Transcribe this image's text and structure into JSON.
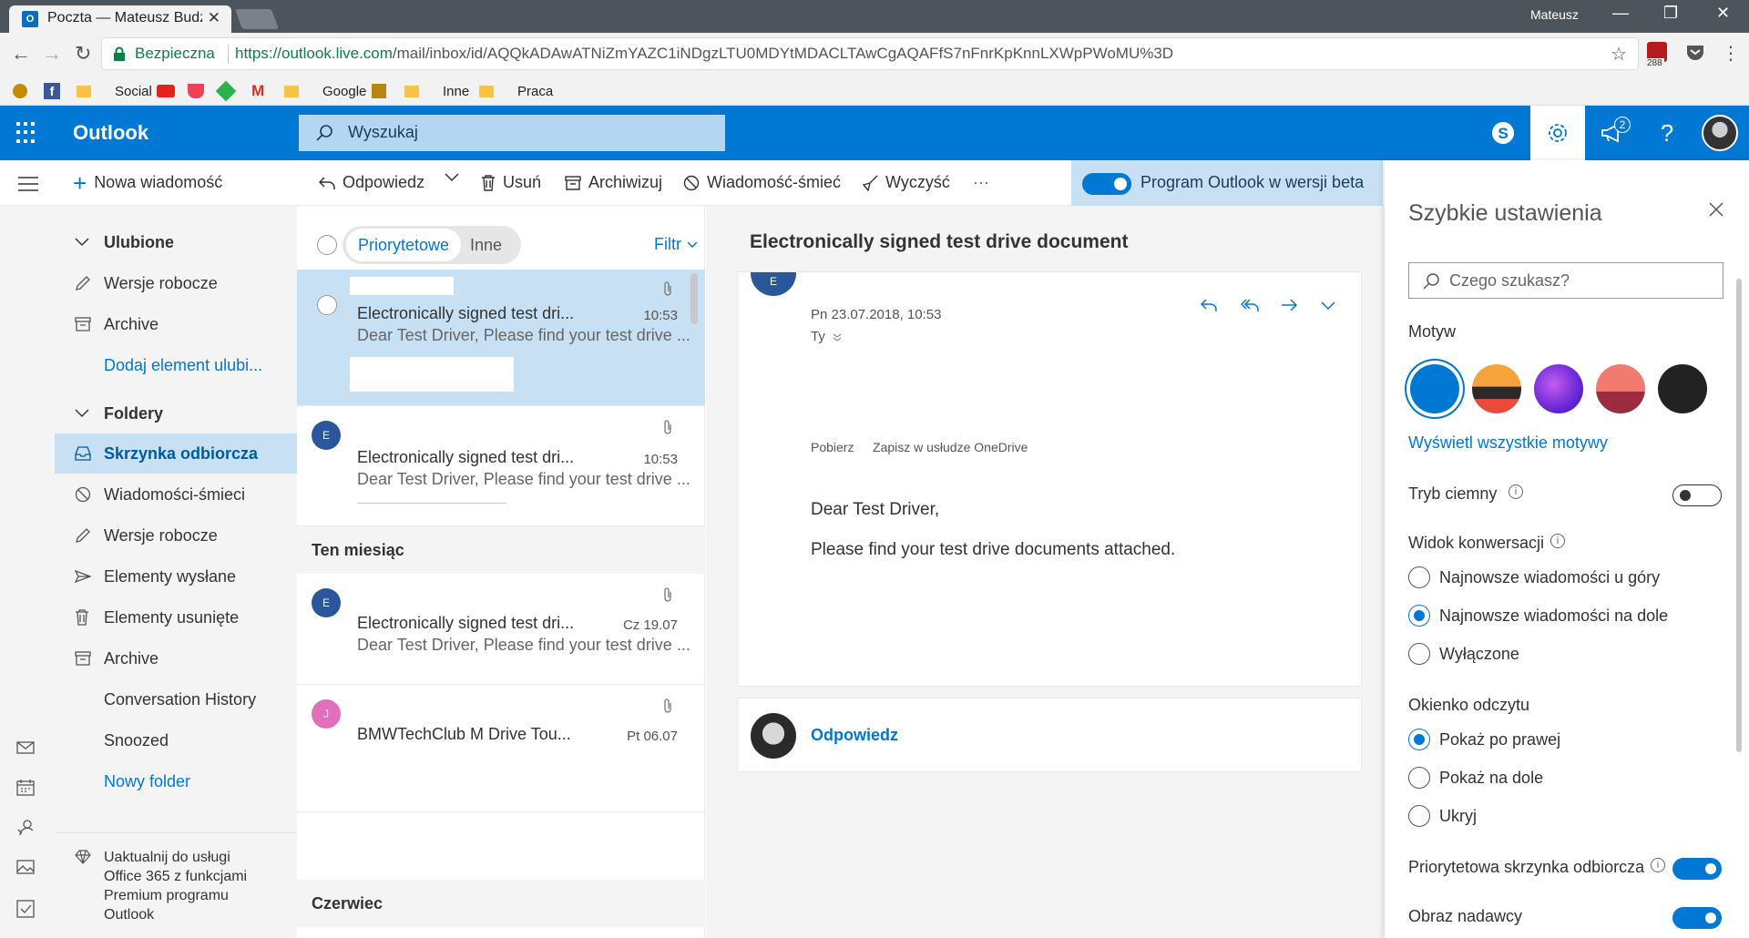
{
  "browser": {
    "tab_title": "Poczta — Mateusz Budze",
    "user": "Mateusz",
    "secure_label": "Bezpieczna",
    "url_host": "https://outlook.live.com",
    "url_path": "/mail/inbox/id/AQQkADAwATNiZmYAZC1iNDgzLTU0MDYtMDACLTAwCgAQAFfS7nFnrKpKnnLXWpPWoMU%3D",
    "extension_badge": "288",
    "bookmarks": [
      {
        "label": "Social",
        "icon": "folder"
      },
      {
        "label": "Google",
        "icon": "folder"
      },
      {
        "label": "Inne",
        "icon": "folder"
      },
      {
        "label": "Praca",
        "icon": "folder"
      }
    ]
  },
  "header": {
    "brand": "Outlook",
    "search_placeholder": "Wyszukaj",
    "notifications_count": "2",
    "accent": "#0078d4"
  },
  "commands": {
    "new_message": "Nowa wiadomość",
    "reply": "Odpowiedz",
    "delete": "Usuń",
    "archive": "Archiwizuj",
    "junk": "Wiadomość-śmieć",
    "sweep": "Wyczyść",
    "more": "···",
    "beta_label": "Program Outlook w wersji beta"
  },
  "folders": {
    "favorites_label": "Ulubione",
    "favorites": [
      {
        "label": "Wersje robocze",
        "icon": "pencil-icon"
      },
      {
        "label": "Archive",
        "icon": "archive-icon"
      },
      {
        "label": "Dodaj element ulubi...",
        "icon": ""
      }
    ],
    "folders_label": "Foldery",
    "items": [
      {
        "label": "Skrzynka odbiorcza",
        "icon": "inbox-icon"
      },
      {
        "label": "Wiadomości-śmieci",
        "icon": "block-icon"
      },
      {
        "label": "Wersje robocze",
        "icon": "pencil-icon"
      },
      {
        "label": "Elementy wysłane",
        "icon": "send-icon"
      },
      {
        "label": "Elementy usunięte",
        "icon": "trash-icon"
      },
      {
        "label": "Archive",
        "icon": "archive-icon"
      },
      {
        "label": "Conversation History",
        "icon": ""
      },
      {
        "label": "Snoozed",
        "icon": ""
      },
      {
        "label": "Nowy folder",
        "icon": ""
      }
    ],
    "upgrade": "Uaktualnij do usługi Office 365 z funkcjami Premium programu Outlook"
  },
  "list": {
    "focused_tab": "Priorytetowe",
    "other_tab": "Inne",
    "filter": "Filtr",
    "messages": [
      {
        "avatar": "",
        "subject": "Electronically signed test dri...",
        "preview": "Dear Test Driver, Please find your test drive ...",
        "time": "10:53",
        "selected": true
      },
      {
        "avatar": "E",
        "subject": "Electronically signed test dri...",
        "preview": "Dear Test Driver, Please find your test drive ...",
        "time": "10:53",
        "selected": false
      }
    ],
    "group_month": "Ten miesiąc",
    "messages_month": [
      {
        "avatar": "E",
        "subject": "Electronically signed test dri...",
        "preview": "Dear Test Driver, Please find your test drive ...",
        "time": "Cz 19.07"
      },
      {
        "avatar": "J",
        "subject": "BMWTechClub M Drive Tou...",
        "preview": "",
        "time": "Pt 06.07"
      }
    ],
    "group_june": "Czerwiec"
  },
  "reading": {
    "subject": "Electronically signed test drive document",
    "avatar": "E",
    "date": "Pn 23.07.2018, 10:53",
    "to": "Ty",
    "download": "Pobierz",
    "save_onedrive": "Zapisz w usłudze OneDrive",
    "greeting": "Dear Test Driver,",
    "body": "Please find your test drive documents attached.",
    "reply": "Odpowiedz"
  },
  "quick_settings": {
    "title": "Szybkie ustawienia",
    "search_placeholder": "Czego szukasz?",
    "theme_label": "Motyw",
    "show_all_themes": "Wyświetl wszystkie motywy",
    "dark_mode": "Tryb ciemny",
    "dark_mode_on": false,
    "conversation_view": "Widok konwersacji",
    "conv_options": [
      "Najnowsze wiadomości u góry",
      "Najnowsze wiadomości na dole",
      "Wyłączone"
    ],
    "conv_selected": 1,
    "reading_pane": "Okienko odczytu",
    "reading_options": [
      "Pokaż po prawej",
      "Pokaż na dole",
      "Ukryj"
    ],
    "reading_selected": 0,
    "focused_inbox": "Priorytetowa skrzynka odbiorcza",
    "focused_inbox_on": true,
    "sender_image": "Obraz nadawcy",
    "sender_image_on": true
  }
}
